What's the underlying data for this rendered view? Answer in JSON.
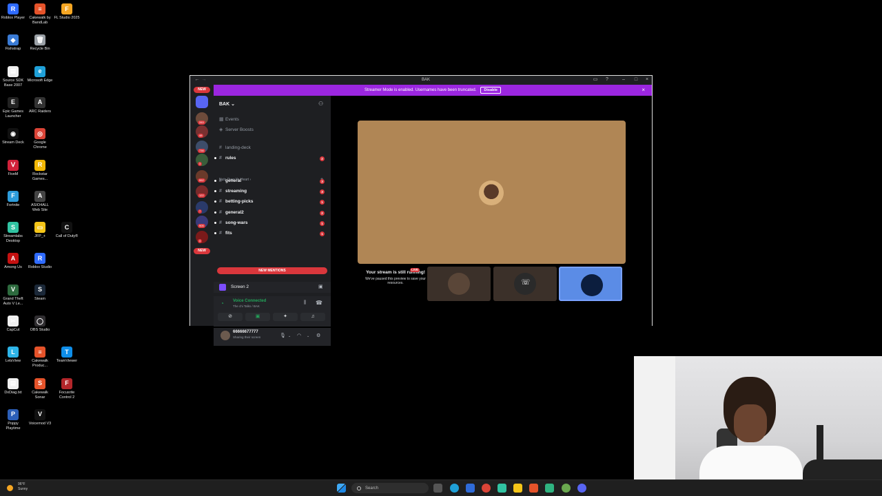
{
  "desktop": {
    "icons": [
      {
        "label": "Roblox Player",
        "color": "#2f6bff",
        "glyph": "R"
      },
      {
        "label": "Cakewalk by BandLab",
        "color": "#e5532a",
        "glyph": "≡"
      },
      {
        "label": "FL Studio 2025",
        "color": "#f5a623",
        "glyph": "F"
      },
      {
        "label": "Fishstrap",
        "color": "#3a7bd5",
        "glyph": "◆"
      },
      {
        "label": "Recycle Bin",
        "color": "#9aa0a6",
        "glyph": "🗑"
      },
      {
        "label": "Source SDK Base 2007",
        "color": "#f0f0f0",
        "glyph": "▤"
      },
      {
        "label": "Microsoft Edge",
        "color": "#1fa0d8",
        "glyph": "e"
      },
      {
        "label": "Epic Games Launcher",
        "color": "#222222",
        "glyph": "E"
      },
      {
        "label": "ARC Raiders",
        "color": "#333333",
        "glyph": "A"
      },
      {
        "label": "Stream Deck",
        "color": "#111111",
        "glyph": "◉"
      },
      {
        "label": "Google Chrome",
        "color": "#db4437",
        "glyph": "◎"
      },
      {
        "label": "FiveM",
        "color": "#d1213a",
        "glyph": "Ⅴ"
      },
      {
        "label": "Rockstar Games...",
        "color": "#f2b705",
        "glyph": "R"
      },
      {
        "label": "Fortnite",
        "color": "#2d9cdb",
        "glyph": "F"
      },
      {
        "label": "ASIO4ALL Web Site",
        "color": "#444444",
        "glyph": "A"
      },
      {
        "label": "Streamlabs Desktop",
        "color": "#31c3a2",
        "glyph": "S"
      },
      {
        "label": "JFP_+",
        "color": "#f5c518",
        "glyph": "▭"
      },
      {
        "label": "Call of Duty®",
        "color": "#111111",
        "glyph": "C"
      },
      {
        "label": "Among Us",
        "color": "#c51111",
        "glyph": "A"
      },
      {
        "label": "Roblox Studio",
        "color": "#2f6bff",
        "glyph": "R"
      },
      {
        "label": "Grand Theft Auto V Le...",
        "color": "#2d6a3e",
        "glyph": "V"
      },
      {
        "label": "Steam",
        "color": "#1b2838",
        "glyph": "S"
      },
      {
        "label": "CapCut",
        "color": "#f0f0f0",
        "glyph": "✂"
      },
      {
        "label": "OBS Studio",
        "color": "#302e31",
        "glyph": "◯"
      },
      {
        "label": "LetsView",
        "color": "#2db4e8",
        "glyph": "L"
      },
      {
        "label": "Cakewalk Produc...",
        "color": "#e5532a",
        "glyph": "≡"
      },
      {
        "label": "TeamViewer",
        "color": "#0e8ee9",
        "glyph": "T"
      },
      {
        "label": "DxDiag.txt",
        "color": "#f0f0f0",
        "glyph": "▤"
      },
      {
        "label": "Cakewalk Sonar",
        "color": "#e5532a",
        "glyph": "S"
      },
      {
        "label": "Focusrite Control 2",
        "color": "#b3262a",
        "glyph": "F"
      },
      {
        "label": "Poppy Playtime",
        "color": "#2c5fb8",
        "glyph": "P"
      },
      {
        "label": "Voicemod V3",
        "color": "#111111",
        "glyph": "V"
      }
    ]
  },
  "taskbar": {
    "weather_temp": "96°F",
    "weather_desc": "Sunny",
    "search_placeholder": "Search"
  },
  "window": {
    "title": "BAK",
    "banner_text": "Streamer Mode is enabled. Usernames have been truncated.",
    "banner_button": "Disable",
    "new_label": "NEW"
  },
  "guild_badges": [
    "283",
    "48",
    "736",
    "3",
    "552",
    "122",
    "7",
    "905",
    "4"
  ],
  "server": {
    "name": "BAK",
    "menu_items": [
      "Events",
      "Server Boosts"
    ],
    "category": "Nuts Over Yo Heart",
    "channels": [
      {
        "name": "landing-deck",
        "badge": "",
        "unread": false
      },
      {
        "name": "rules",
        "badge": "2",
        "unread": true
      },
      {
        "name": "general",
        "badge": "3",
        "unread": true
      },
      {
        "name": "streaming",
        "badge": "3",
        "unread": true
      },
      {
        "name": "betting-picks",
        "badge": "1",
        "unread": true
      },
      {
        "name": "general2",
        "badge": "2",
        "unread": true
      },
      {
        "name": "song-wars",
        "badge": "1",
        "unread": true
      },
      {
        "name": "fits",
        "badge": "1",
        "unread": true
      }
    ],
    "new_mentions": "NEW MENTIONS"
  },
  "screen_share": {
    "label": "Screen 2"
  },
  "voice": {
    "status": "Voice Connected",
    "channel": "The chi Talks / BAK"
  },
  "user": {
    "name": "66666677777",
    "status": "Sharing their screen"
  },
  "stage": {
    "paused_title": "Your stream is still running!",
    "paused_body": "We've paused this preview to save your resources.",
    "live_badge": "LIVE"
  },
  "colors": {
    "banner": "#9b26e0",
    "voice_connected": "#23a55a",
    "mention_red": "#da373c",
    "selected_tile": "#5b8ce6"
  }
}
